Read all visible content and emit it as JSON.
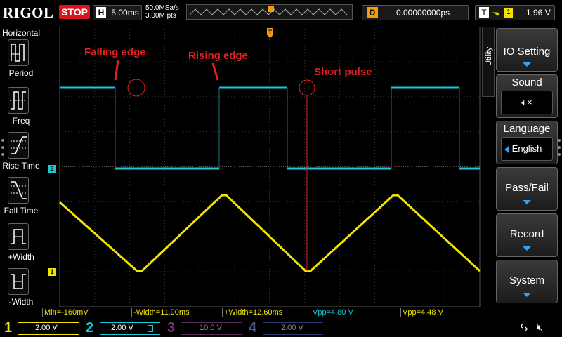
{
  "header": {
    "logo": "RIGOL",
    "run_state": "STOP",
    "horizontal_label": "H",
    "timebase": "5.00ms",
    "sample_rate": "50.0MSa/s",
    "memory_depth": "3.00M pts",
    "delay_label": "D",
    "delay_value": "0.00000000ps",
    "trigger_label": "T",
    "trigger_slope_icon": "falling-edge-icon",
    "trigger_source": "1",
    "trigger_level": "1.96 V"
  },
  "left_panel": {
    "title": "Horizontal",
    "items": [
      {
        "label": "Period",
        "icon": "period-icon"
      },
      {
        "label": "Freq",
        "icon": "frequency-icon"
      },
      {
        "label": "Rise Time",
        "icon": "rise-time-icon"
      },
      {
        "label": "Fall Time",
        "icon": "fall-time-icon"
      },
      {
        "label": "+Width",
        "icon": "positive-width-icon"
      },
      {
        "label": "-Width",
        "icon": "negative-width-icon"
      }
    ]
  },
  "annotations": {
    "falling_edge": "Falling edge",
    "rising_edge": "Rising edge",
    "short_pulse": "Short pulse"
  },
  "markers": {
    "ch2": "2",
    "ch1": "1",
    "trigger": "T"
  },
  "measurements": [
    {
      "text": "Min=-160mV",
      "color": "yellow"
    },
    {
      "text": "-Width=11.90ms",
      "color": "yellow"
    },
    {
      "text": "+Width=12.60ms",
      "color": "yellow"
    },
    {
      "text": "Vpp=4.80 V",
      "color": "cyan"
    },
    {
      "text": "Vpp=4.48 V",
      "color": "yellow"
    }
  ],
  "channels": [
    {
      "num": "1",
      "scale": "2.00 V",
      "color": "#f1e500",
      "active": true
    },
    {
      "num": "2",
      "scale": "2.00 V",
      "color": "#19c8d8",
      "active": true,
      "bw_icon": "bw-limit-icon"
    },
    {
      "num": "3",
      "scale": "10.0 V",
      "color": "#c040c0",
      "active": false
    },
    {
      "num": "4",
      "scale": "2.00 V",
      "color": "#3060d0",
      "active": false
    }
  ],
  "status_icons": [
    "usb-icon",
    "speaker-muted-icon"
  ],
  "right_menu": {
    "tab": "Utility",
    "items": [
      {
        "label": "IO Setting",
        "type": "submenu"
      },
      {
        "label": "Sound",
        "type": "toggle",
        "value_icon": "speaker-muted-icon"
      },
      {
        "label": "Language",
        "type": "select",
        "value": "English"
      },
      {
        "label": "Pass/Fail",
        "type": "submenu"
      },
      {
        "label": "Record",
        "type": "submenu"
      },
      {
        "label": "System",
        "type": "submenu"
      }
    ]
  },
  "colors": {
    "ch1": "#f1e500",
    "ch2": "#19c8d8",
    "stop": "#d8141c",
    "annotation": "#e02020",
    "trigger": "#f39c12",
    "menu_arrow": "#29a6ff"
  }
}
